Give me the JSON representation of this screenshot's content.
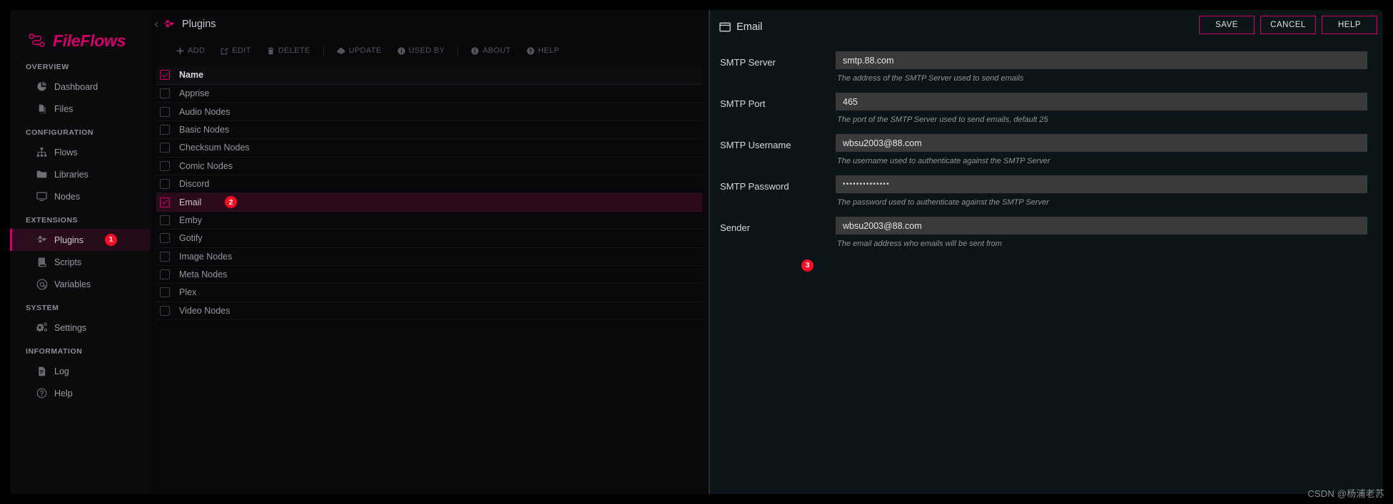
{
  "app": {
    "brand_name": "FileFlows",
    "brand_logo_icon": "fileflows-logo-icon"
  },
  "sidebar": {
    "sections": [
      {
        "label": "OVERVIEW",
        "items": [
          {
            "label": "Dashboard",
            "icon": "pie-chart-icon",
            "active": false
          },
          {
            "label": "Files",
            "icon": "files-icon",
            "active": false
          }
        ]
      },
      {
        "label": "CONFIGURATION",
        "items": [
          {
            "label": "Flows",
            "icon": "sitemap-icon",
            "active": false
          },
          {
            "label": "Libraries",
            "icon": "folder-icon",
            "active": false
          },
          {
            "label": "Nodes",
            "icon": "monitor-icon",
            "active": false
          }
        ]
      },
      {
        "label": "EXTENSIONS",
        "items": [
          {
            "label": "Plugins",
            "icon": "plugin-icon",
            "active": true,
            "badge": "1"
          },
          {
            "label": "Scripts",
            "icon": "scroll-icon",
            "active": false
          },
          {
            "label": "Variables",
            "icon": "at-sign-icon",
            "active": false
          }
        ]
      },
      {
        "label": "SYSTEM",
        "items": [
          {
            "label": "Settings",
            "icon": "gear-icon",
            "active": false
          }
        ]
      },
      {
        "label": "INFORMATION",
        "items": [
          {
            "label": "Log",
            "icon": "log-file-icon",
            "active": false
          },
          {
            "label": "Help",
            "icon": "question-circle-icon",
            "active": false
          }
        ]
      }
    ]
  },
  "center": {
    "title": "Plugins",
    "title_icon": "plugin-icon",
    "collapse_icon": "chevron-left-icon",
    "toolbar": [
      {
        "label": "ADD",
        "icon": "plus-icon"
      },
      {
        "label": "EDIT",
        "icon": "pencil-square-icon"
      },
      {
        "label": "DELETE",
        "icon": "trash-icon"
      },
      {
        "label": "UPDATE",
        "icon": "cloud-download-icon"
      },
      {
        "label": "USED BY",
        "icon": "info-circle-icon"
      },
      {
        "label": "ABOUT",
        "icon": "info-circle-icon"
      },
      {
        "label": "HELP",
        "icon": "question-circle-icon"
      }
    ],
    "grid": {
      "column_header": "Name",
      "header_checked": true,
      "rows": [
        {
          "name": "Apprise",
          "checked": false,
          "selected": false
        },
        {
          "name": "Audio Nodes",
          "checked": false,
          "selected": false
        },
        {
          "name": "Basic Nodes",
          "checked": false,
          "selected": false
        },
        {
          "name": "Checksum Nodes",
          "checked": false,
          "selected": false
        },
        {
          "name": "Comic Nodes",
          "checked": false,
          "selected": false
        },
        {
          "name": "Discord",
          "checked": false,
          "selected": false
        },
        {
          "name": "Email",
          "checked": true,
          "selected": true,
          "badge": "2"
        },
        {
          "name": "Emby",
          "checked": false,
          "selected": false
        },
        {
          "name": "Gotify",
          "checked": false,
          "selected": false
        },
        {
          "name": "Image Nodes",
          "checked": false,
          "selected": false
        },
        {
          "name": "Meta Nodes",
          "checked": false,
          "selected": false
        },
        {
          "name": "Plex",
          "checked": false,
          "selected": false
        },
        {
          "name": "Video Nodes",
          "checked": false,
          "selected": false
        }
      ]
    }
  },
  "right_panel": {
    "title": "Email",
    "title_icon": "window-icon",
    "actions": [
      {
        "label": "SAVE",
        "name": "save-button"
      },
      {
        "label": "CANCEL",
        "name": "cancel-button"
      },
      {
        "label": "HELP",
        "name": "help-button"
      }
    ],
    "fields": [
      {
        "label": "SMTP Server",
        "value": "smtp.88.com",
        "help": "The address of the SMTP Server used to send emails",
        "type": "text"
      },
      {
        "label": "SMTP Port",
        "value": "465",
        "help": "The port of the SMTP Server used to send emails, default 25",
        "type": "text"
      },
      {
        "label": "SMTP Username",
        "value": "wbsu2003@88.com",
        "help": "The username used to authenticate against the SMTP Server",
        "type": "text"
      },
      {
        "label": "SMTP Password",
        "value": "••••••••••••••",
        "help": "The password used to authenticate against the SMTP Server",
        "type": "password"
      },
      {
        "label": "Sender",
        "value": "wbsu2003@88.com",
        "help": "The email address who emails will be sent from",
        "type": "text"
      }
    ],
    "badge": "3"
  },
  "watermark": "CSDN @杨浦老苏",
  "colors": {
    "accent": "#d3006b",
    "badge": "#f50f26",
    "sidebar_bg": "#0b0b0d",
    "center_bg": "#08080a",
    "right_bg": "#0b1416",
    "input_bg": "#3a3a3a"
  }
}
